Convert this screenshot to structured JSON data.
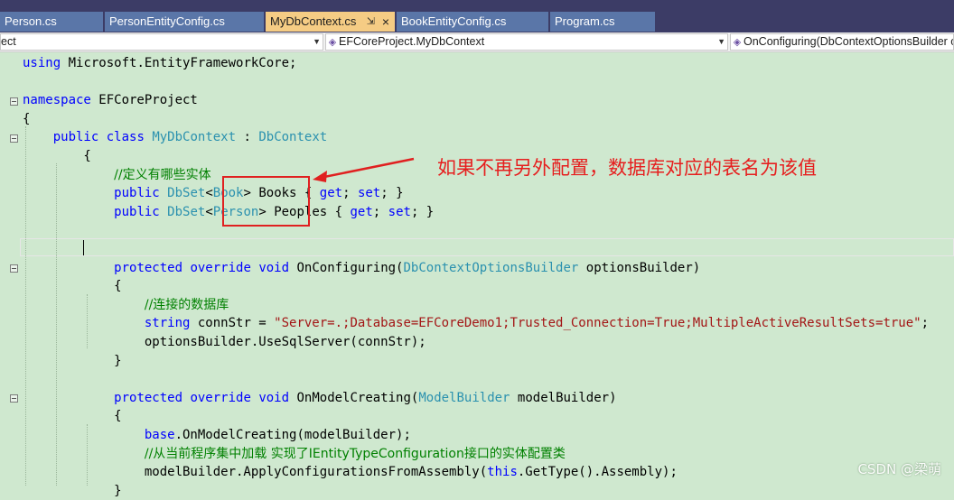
{
  "tabs": [
    {
      "label": "Person.cs",
      "active": false
    },
    {
      "label": "PersonEntityConfig.cs",
      "active": false
    },
    {
      "label": "MyDbContext.cs",
      "active": true,
      "pin": "⇲",
      "close": "×"
    },
    {
      "label": "BookEntityConfig.cs",
      "active": false
    },
    {
      "label": "Program.cs",
      "active": false
    }
  ],
  "navbar": {
    "project": "ect",
    "class_scope": "EFCoreProject.MyDbContext",
    "member_scope": "OnConfiguring(DbContextOptionsBuilder optionsBuilder)"
  },
  "code_lines": [
    [
      [
        "kw",
        "using"
      ],
      [
        "tx",
        " Microsoft.EntityFrameworkCore;"
      ]
    ],
    [],
    [
      [
        "kw",
        "namespace"
      ],
      [
        "tx",
        " EFCoreProject"
      ]
    ],
    [
      [
        "tx",
        "{"
      ]
    ],
    [
      [
        "tx",
        "    "
      ],
      [
        "kw",
        "public"
      ],
      [
        "tx",
        " "
      ],
      [
        "kw",
        "class"
      ],
      [
        "tx",
        " "
      ],
      [
        "ty",
        "MyDbContext"
      ],
      [
        "tx",
        " : "
      ],
      [
        "ty",
        "DbContext"
      ]
    ],
    [
      [
        "tx",
        "        {"
      ]
    ],
    [
      [
        "tx",
        "            "
      ],
      [
        "cm",
        "//定义有哪些实体"
      ]
    ],
    [
      [
        "tx",
        "            "
      ],
      [
        "kw",
        "public"
      ],
      [
        "tx",
        " "
      ],
      [
        "ty",
        "DbSet"
      ],
      [
        "tx",
        "<"
      ],
      [
        "ty",
        "Book"
      ],
      [
        "tx",
        "> Books { "
      ],
      [
        "kw",
        "get"
      ],
      [
        "tx",
        "; "
      ],
      [
        "kw",
        "set"
      ],
      [
        "tx",
        "; }"
      ]
    ],
    [
      [
        "tx",
        "            "
      ],
      [
        "kw",
        "public"
      ],
      [
        "tx",
        " "
      ],
      [
        "ty",
        "DbSet"
      ],
      [
        "tx",
        "<"
      ],
      [
        "ty",
        "Person"
      ],
      [
        "tx",
        "> Peoples { "
      ],
      [
        "kw",
        "get"
      ],
      [
        "tx",
        "; "
      ],
      [
        "kw",
        "set"
      ],
      [
        "tx",
        "; }"
      ]
    ],
    [],
    [],
    [
      [
        "tx",
        "            "
      ],
      [
        "kw",
        "protected"
      ],
      [
        "tx",
        " "
      ],
      [
        "kw",
        "override"
      ],
      [
        "tx",
        " "
      ],
      [
        "kw",
        "void"
      ],
      [
        "tx",
        " OnConfiguring("
      ],
      [
        "ty",
        "DbContextOptionsBuilder"
      ],
      [
        "tx",
        " optionsBuilder)"
      ]
    ],
    [
      [
        "tx",
        "            {"
      ]
    ],
    [
      [
        "tx",
        "                "
      ],
      [
        "cm",
        "//连接的数据库"
      ]
    ],
    [
      [
        "tx",
        "                "
      ],
      [
        "kw",
        "string"
      ],
      [
        "tx",
        " connStr = "
      ],
      [
        "st",
        "\"Server=.;Database=EFCoreDemo1;Trusted_Connection=True;MultipleActiveResultSets=true\""
      ],
      [
        "tx",
        ";"
      ]
    ],
    [
      [
        "tx",
        "                optionsBuilder.UseSqlServer(connStr);"
      ]
    ],
    [
      [
        "tx",
        "            }"
      ]
    ],
    [],
    [
      [
        "tx",
        "            "
      ],
      [
        "kw",
        "protected"
      ],
      [
        "tx",
        " "
      ],
      [
        "kw",
        "override"
      ],
      [
        "tx",
        " "
      ],
      [
        "kw",
        "void"
      ],
      [
        "tx",
        " OnModelCreating("
      ],
      [
        "ty",
        "ModelBuilder"
      ],
      [
        "tx",
        " modelBuilder)"
      ]
    ],
    [
      [
        "tx",
        "            {"
      ]
    ],
    [
      [
        "tx",
        "                "
      ],
      [
        "kw",
        "base"
      ],
      [
        "tx",
        ".OnModelCreating(modelBuilder);"
      ]
    ],
    [
      [
        "tx",
        "                "
      ],
      [
        "cm",
        "//从当前程序集中加载 实现了IEntityTypeConfiguration接口的实体配置类"
      ]
    ],
    [
      [
        "tx",
        "                modelBuilder.ApplyConfigurationsFromAssembly("
      ],
      [
        "kw",
        "this"
      ],
      [
        "tx",
        ".GetType().Assembly);"
      ]
    ],
    [
      [
        "tx",
        "            }"
      ]
    ]
  ],
  "annotation": "如果不再另外配置，数据库对应的表名为该值",
  "watermark": "CSDN @梁萌",
  "colors": {
    "keyword": "#0000ff",
    "type": "#2b91af",
    "comment": "#008000",
    "string": "#a31515",
    "annotation": "#e61e1e"
  }
}
